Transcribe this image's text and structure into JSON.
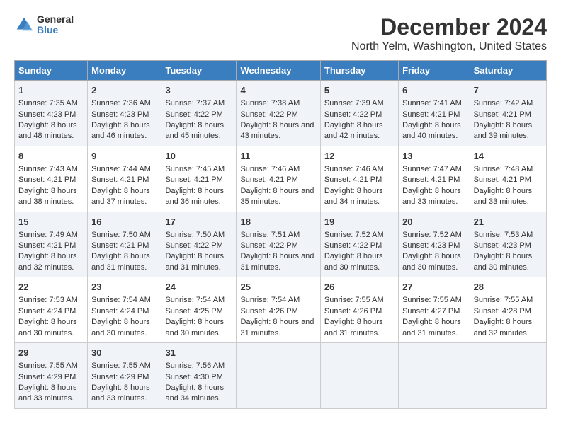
{
  "logo": {
    "general": "General",
    "blue": "Blue"
  },
  "title": "December 2024",
  "subtitle": "North Yelm, Washington, United States",
  "headers": [
    "Sunday",
    "Monday",
    "Tuesday",
    "Wednesday",
    "Thursday",
    "Friday",
    "Saturday"
  ],
  "weeks": [
    [
      {
        "day": "1",
        "sunrise": "Sunrise: 7:35 AM",
        "sunset": "Sunset: 4:23 PM",
        "daylight": "Daylight: 8 hours and 48 minutes."
      },
      {
        "day": "2",
        "sunrise": "Sunrise: 7:36 AM",
        "sunset": "Sunset: 4:23 PM",
        "daylight": "Daylight: 8 hours and 46 minutes."
      },
      {
        "day": "3",
        "sunrise": "Sunrise: 7:37 AM",
        "sunset": "Sunset: 4:22 PM",
        "daylight": "Daylight: 8 hours and 45 minutes."
      },
      {
        "day": "4",
        "sunrise": "Sunrise: 7:38 AM",
        "sunset": "Sunset: 4:22 PM",
        "daylight": "Daylight: 8 hours and 43 minutes."
      },
      {
        "day": "5",
        "sunrise": "Sunrise: 7:39 AM",
        "sunset": "Sunset: 4:22 PM",
        "daylight": "Daylight: 8 hours and 42 minutes."
      },
      {
        "day": "6",
        "sunrise": "Sunrise: 7:41 AM",
        "sunset": "Sunset: 4:21 PM",
        "daylight": "Daylight: 8 hours and 40 minutes."
      },
      {
        "day": "7",
        "sunrise": "Sunrise: 7:42 AM",
        "sunset": "Sunset: 4:21 PM",
        "daylight": "Daylight: 8 hours and 39 minutes."
      }
    ],
    [
      {
        "day": "8",
        "sunrise": "Sunrise: 7:43 AM",
        "sunset": "Sunset: 4:21 PM",
        "daylight": "Daylight: 8 hours and 38 minutes."
      },
      {
        "day": "9",
        "sunrise": "Sunrise: 7:44 AM",
        "sunset": "Sunset: 4:21 PM",
        "daylight": "Daylight: 8 hours and 37 minutes."
      },
      {
        "day": "10",
        "sunrise": "Sunrise: 7:45 AM",
        "sunset": "Sunset: 4:21 PM",
        "daylight": "Daylight: 8 hours and 36 minutes."
      },
      {
        "day": "11",
        "sunrise": "Sunrise: 7:46 AM",
        "sunset": "Sunset: 4:21 PM",
        "daylight": "Daylight: 8 hours and 35 minutes."
      },
      {
        "day": "12",
        "sunrise": "Sunrise: 7:46 AM",
        "sunset": "Sunset: 4:21 PM",
        "daylight": "Daylight: 8 hours and 34 minutes."
      },
      {
        "day": "13",
        "sunrise": "Sunrise: 7:47 AM",
        "sunset": "Sunset: 4:21 PM",
        "daylight": "Daylight: 8 hours and 33 minutes."
      },
      {
        "day": "14",
        "sunrise": "Sunrise: 7:48 AM",
        "sunset": "Sunset: 4:21 PM",
        "daylight": "Daylight: 8 hours and 33 minutes."
      }
    ],
    [
      {
        "day": "15",
        "sunrise": "Sunrise: 7:49 AM",
        "sunset": "Sunset: 4:21 PM",
        "daylight": "Daylight: 8 hours and 32 minutes."
      },
      {
        "day": "16",
        "sunrise": "Sunrise: 7:50 AM",
        "sunset": "Sunset: 4:21 PM",
        "daylight": "Daylight: 8 hours and 31 minutes."
      },
      {
        "day": "17",
        "sunrise": "Sunrise: 7:50 AM",
        "sunset": "Sunset: 4:22 PM",
        "daylight": "Daylight: 8 hours and 31 minutes."
      },
      {
        "day": "18",
        "sunrise": "Sunrise: 7:51 AM",
        "sunset": "Sunset: 4:22 PM",
        "daylight": "Daylight: 8 hours and 31 minutes."
      },
      {
        "day": "19",
        "sunrise": "Sunrise: 7:52 AM",
        "sunset": "Sunset: 4:22 PM",
        "daylight": "Daylight: 8 hours and 30 minutes."
      },
      {
        "day": "20",
        "sunrise": "Sunrise: 7:52 AM",
        "sunset": "Sunset: 4:23 PM",
        "daylight": "Daylight: 8 hours and 30 minutes."
      },
      {
        "day": "21",
        "sunrise": "Sunrise: 7:53 AM",
        "sunset": "Sunset: 4:23 PM",
        "daylight": "Daylight: 8 hours and 30 minutes."
      }
    ],
    [
      {
        "day": "22",
        "sunrise": "Sunrise: 7:53 AM",
        "sunset": "Sunset: 4:24 PM",
        "daylight": "Daylight: 8 hours and 30 minutes."
      },
      {
        "day": "23",
        "sunrise": "Sunrise: 7:54 AM",
        "sunset": "Sunset: 4:24 PM",
        "daylight": "Daylight: 8 hours and 30 minutes."
      },
      {
        "day": "24",
        "sunrise": "Sunrise: 7:54 AM",
        "sunset": "Sunset: 4:25 PM",
        "daylight": "Daylight: 8 hours and 30 minutes."
      },
      {
        "day": "25",
        "sunrise": "Sunrise: 7:54 AM",
        "sunset": "Sunset: 4:26 PM",
        "daylight": "Daylight: 8 hours and 31 minutes."
      },
      {
        "day": "26",
        "sunrise": "Sunrise: 7:55 AM",
        "sunset": "Sunset: 4:26 PM",
        "daylight": "Daylight: 8 hours and 31 minutes."
      },
      {
        "day": "27",
        "sunrise": "Sunrise: 7:55 AM",
        "sunset": "Sunset: 4:27 PM",
        "daylight": "Daylight: 8 hours and 31 minutes."
      },
      {
        "day": "28",
        "sunrise": "Sunrise: 7:55 AM",
        "sunset": "Sunset: 4:28 PM",
        "daylight": "Daylight: 8 hours and 32 minutes."
      }
    ],
    [
      {
        "day": "29",
        "sunrise": "Sunrise: 7:55 AM",
        "sunset": "Sunset: 4:29 PM",
        "daylight": "Daylight: 8 hours and 33 minutes."
      },
      {
        "day": "30",
        "sunrise": "Sunrise: 7:55 AM",
        "sunset": "Sunset: 4:29 PM",
        "daylight": "Daylight: 8 hours and 33 minutes."
      },
      {
        "day": "31",
        "sunrise": "Sunrise: 7:56 AM",
        "sunset": "Sunset: 4:30 PM",
        "daylight": "Daylight: 8 hours and 34 minutes."
      },
      null,
      null,
      null,
      null
    ]
  ]
}
